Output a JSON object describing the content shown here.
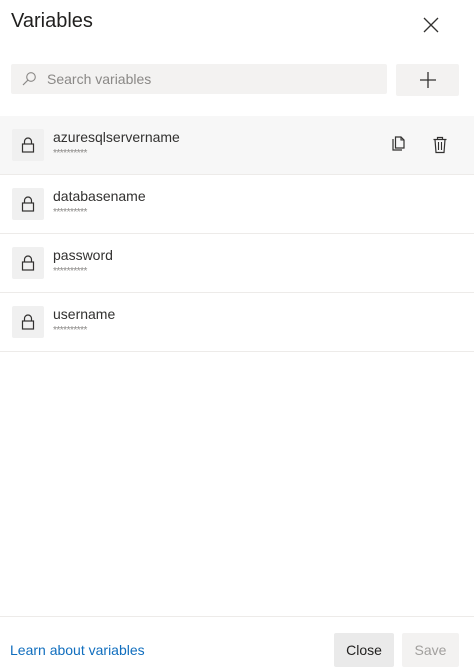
{
  "header": {
    "title": "Variables",
    "close_icon": "close-icon"
  },
  "search": {
    "placeholder": "Search variables",
    "value": "",
    "icon": "search-icon"
  },
  "add_button": {
    "icon": "plus-icon"
  },
  "variables": [
    {
      "name": "azuresqlservername",
      "value": "**********",
      "icon": "lock-icon",
      "selected": true
    },
    {
      "name": "databasename",
      "value": "**********",
      "icon": "lock-icon",
      "selected": false
    },
    {
      "name": "password",
      "value": "**********",
      "icon": "lock-icon",
      "selected": false
    },
    {
      "name": "username",
      "value": "**********",
      "icon": "lock-icon",
      "selected": false
    }
  ],
  "row_actions": {
    "copy_icon": "copy-icon",
    "delete_icon": "trash-icon"
  },
  "footer": {
    "learn_link": "Learn about variables",
    "close_label": "Close",
    "save_label": "Save"
  },
  "colors": {
    "link": "#106ebe",
    "field_bg": "#f3f2f1",
    "selected_row_bg": "#f7f7f7",
    "disabled_text": "#a19f9d"
  }
}
